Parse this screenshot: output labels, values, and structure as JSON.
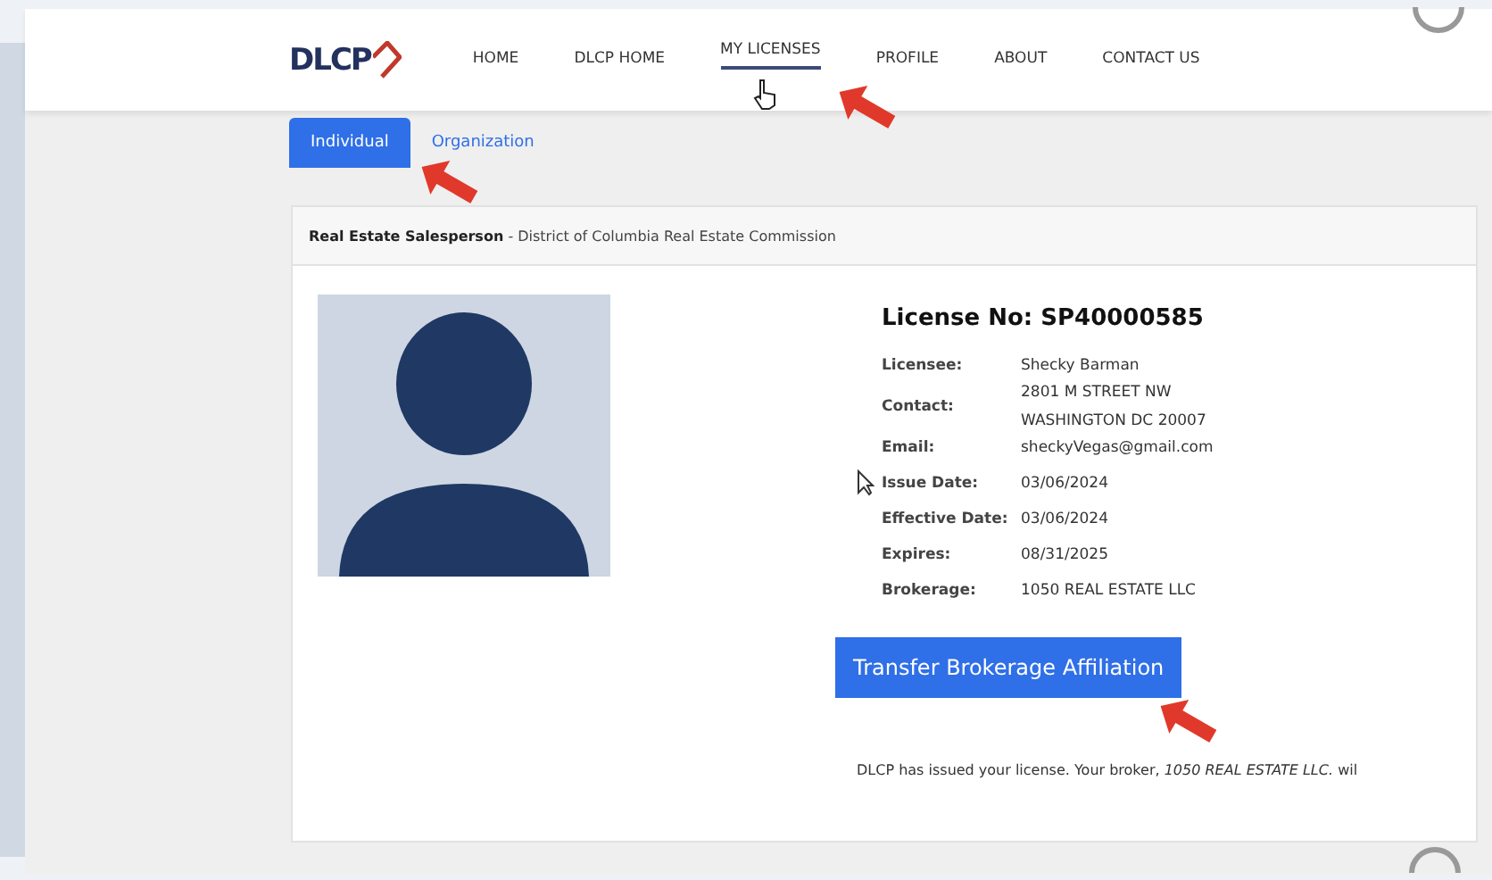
{
  "logo": "DLCP",
  "nav": [
    {
      "label": "HOME",
      "selected": false
    },
    {
      "label": "DLCP HOME",
      "selected": false
    },
    {
      "label": "MY LICENSES",
      "selected": true
    },
    {
      "label": "PROFILE",
      "selected": false
    },
    {
      "label": "ABOUT",
      "selected": false
    },
    {
      "label": "CONTACT US",
      "selected": false
    }
  ],
  "tabs": [
    {
      "label": "Individual",
      "selected": true
    },
    {
      "label": "Organization",
      "selected": false
    }
  ],
  "card": {
    "header_title": "Real Estate Salesperson",
    "header_detail": "- District of Columbia Real Estate Commission",
    "license_no": "License No: SP40000585",
    "fields": [
      {
        "label": "Licensee:",
        "lines": [
          "Shecky Barman"
        ]
      },
      {
        "label": "Contact:",
        "lines": [
          "2801 M STREET NW",
          "WASHINGTON DC 20007"
        ]
      },
      {
        "label": "Email:",
        "lines": [
          "sheckyVegas@gmail.com"
        ]
      },
      {
        "label": "Issue Date:",
        "lines": [
          "03/06/2024"
        ]
      },
      {
        "label": "Effective Date:",
        "lines": [
          "03/06/2024"
        ]
      },
      {
        "label": "Expires:",
        "lines": [
          "08/31/2025"
        ]
      },
      {
        "label": "Brokerage:",
        "lines": [
          "1050 REAL ESTATE LLC"
        ]
      }
    ],
    "button": "Transfer Brokerage Affiliation",
    "notice": "DLCP has issued your license. Your broker, *1050 REAL ESTATE LLC.* wil"
  }
}
